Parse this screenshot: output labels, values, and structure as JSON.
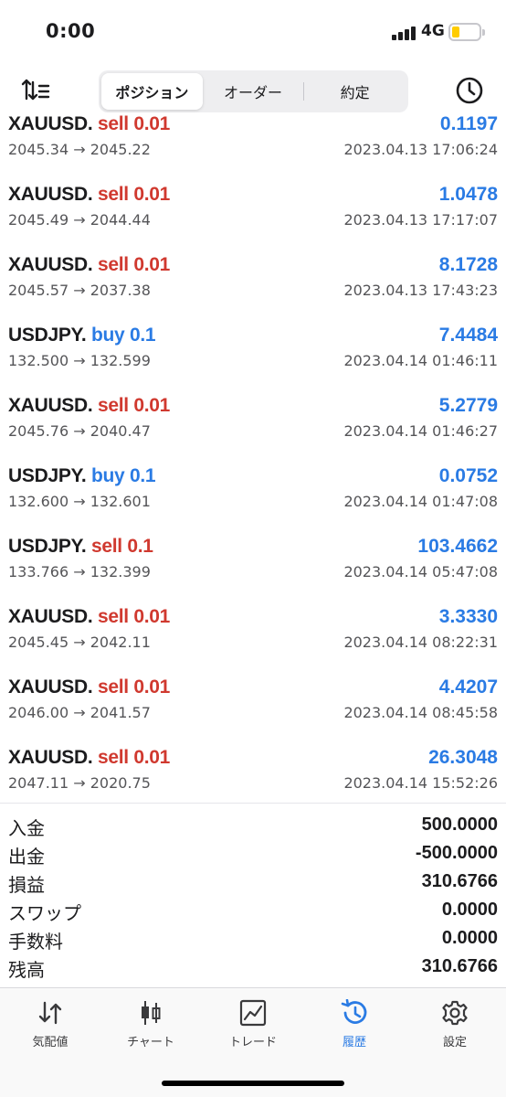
{
  "status_bar": {
    "time": "0:00",
    "network": "4G",
    "battery_color": "#ffcc00"
  },
  "toolbar": {
    "sort_icon": "sort-icon",
    "segments": [
      {
        "label": "ポジション",
        "active": true
      },
      {
        "label": "オーダー",
        "active": false
      },
      {
        "label": "約定",
        "active": false
      }
    ],
    "history_icon": "clock-icon"
  },
  "colors": {
    "sell": "#d0392f",
    "buy": "#2a7be4",
    "profit": "#2a7be4",
    "active_tab": "#2a7be4"
  },
  "deals": [
    {
      "symbol": "XAUUSD.",
      "side": "sell",
      "volume": "0.01",
      "prices": "2045.34 → 2045.22",
      "profit": "0.1197",
      "time": "2023.04.13 17:06:24"
    },
    {
      "symbol": "XAUUSD.",
      "side": "sell",
      "volume": "0.01",
      "prices": "2045.49 → 2044.44",
      "profit": "1.0478",
      "time": "2023.04.13 17:17:07"
    },
    {
      "symbol": "XAUUSD.",
      "side": "sell",
      "volume": "0.01",
      "prices": "2045.57 → 2037.38",
      "profit": "8.1728",
      "time": "2023.04.13 17:43:23"
    },
    {
      "symbol": "USDJPY.",
      "side": "buy",
      "volume": "0.1",
      "prices": "132.500 → 132.599",
      "profit": "7.4484",
      "time": "2023.04.14 01:46:11"
    },
    {
      "symbol": "XAUUSD.",
      "side": "sell",
      "volume": "0.01",
      "prices": "2045.76 → 2040.47",
      "profit": "5.2779",
      "time": "2023.04.14 01:46:27"
    },
    {
      "symbol": "USDJPY.",
      "side": "buy",
      "volume": "0.1",
      "prices": "132.600 → 132.601",
      "profit": "0.0752",
      "time": "2023.04.14 01:47:08"
    },
    {
      "symbol": "USDJPY.",
      "side": "sell",
      "volume": "0.1",
      "prices": "133.766 → 132.399",
      "profit": "103.4662",
      "time": "2023.04.14 05:47:08"
    },
    {
      "symbol": "XAUUSD.",
      "side": "sell",
      "volume": "0.01",
      "prices": "2045.45 → 2042.11",
      "profit": "3.3330",
      "time": "2023.04.14 08:22:31"
    },
    {
      "symbol": "XAUUSD.",
      "side": "sell",
      "volume": "0.01",
      "prices": "2046.00 → 2041.57",
      "profit": "4.4207",
      "time": "2023.04.14 08:45:58"
    },
    {
      "symbol": "XAUUSD.",
      "side": "sell",
      "volume": "0.01",
      "prices": "2047.11 → 2020.75",
      "profit": "26.3048",
      "time": "2023.04.14 15:52:26"
    }
  ],
  "summary": [
    {
      "label": "入金",
      "value": "500.0000"
    },
    {
      "label": "出金",
      "value": "-500.0000"
    },
    {
      "label": "損益",
      "value": "310.6766"
    },
    {
      "label": "スワップ",
      "value": "0.0000"
    },
    {
      "label": "手数料",
      "value": "0.0000"
    },
    {
      "label": "残高",
      "value": "310.6766"
    }
  ],
  "tabs": [
    {
      "label": "気配値",
      "icon": "quotes-icon",
      "active": false
    },
    {
      "label": "チャート",
      "icon": "chart-icon",
      "active": false
    },
    {
      "label": "トレード",
      "icon": "trade-icon",
      "active": false
    },
    {
      "label": "履歴",
      "icon": "history-icon",
      "active": true
    },
    {
      "label": "設定",
      "icon": "settings-icon",
      "active": false
    }
  ]
}
